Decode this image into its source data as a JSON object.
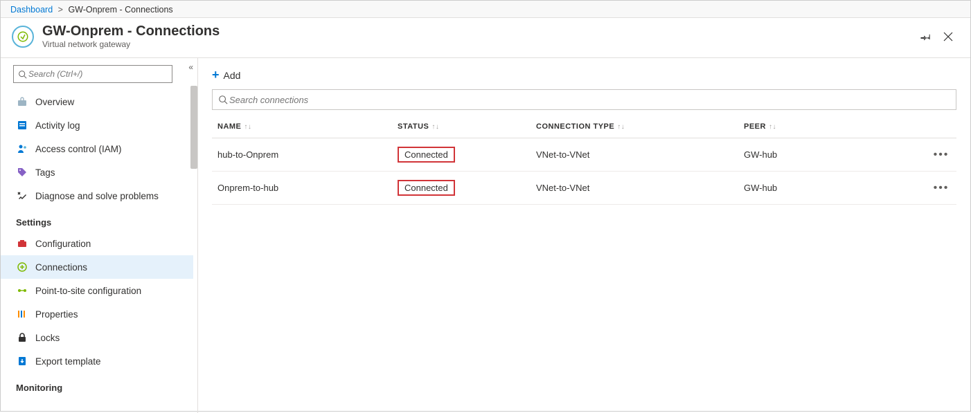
{
  "breadcrumb": {
    "root": "Dashboard",
    "current": "GW-Onprem - Connections"
  },
  "header": {
    "title": "GW-Onprem - Connections",
    "subtitle": "Virtual network gateway"
  },
  "sidebar": {
    "search_placeholder": "Search (Ctrl+/)",
    "items_top": [
      {
        "icon": "overview-icon",
        "label": "Overview",
        "color": "#59b4d9"
      },
      {
        "icon": "activity-log-icon",
        "label": "Activity log",
        "color": "#0078d4"
      },
      {
        "icon": "access-control-icon",
        "label": "Access control (IAM)",
        "color": "#0078d4"
      },
      {
        "icon": "tag-icon",
        "label": "Tags",
        "color": "#7e3e9d"
      },
      {
        "icon": "diagnose-icon",
        "label": "Diagnose and solve problems",
        "color": "#323130"
      }
    ],
    "section_settings": "Settings",
    "items_settings": [
      {
        "icon": "configuration-icon",
        "label": "Configuration",
        "color": "#d13438"
      },
      {
        "icon": "connections-icon",
        "label": "Connections",
        "color": "#57a300",
        "selected": true
      },
      {
        "icon": "p2s-icon",
        "label": "Point-to-site configuration",
        "color": "#57a300"
      },
      {
        "icon": "properties-icon",
        "label": "Properties",
        "color": "#ff8c00"
      },
      {
        "icon": "locks-icon",
        "label": "Locks",
        "color": "#323130"
      },
      {
        "icon": "export-template-icon",
        "label": "Export template",
        "color": "#0078d4"
      }
    ],
    "section_monitoring": "Monitoring"
  },
  "toolbar": {
    "add_label": "Add"
  },
  "content": {
    "search_placeholder": "Search connections",
    "columns": {
      "name": "NAME",
      "status": "STATUS",
      "ctype": "CONNECTION TYPE",
      "peer": "PEER"
    },
    "rows": [
      {
        "name": "hub-to-Onprem",
        "status": "Connected",
        "ctype": "VNet-to-VNet",
        "peer": "GW-hub"
      },
      {
        "name": "Onprem-to-hub",
        "status": "Connected",
        "ctype": "VNet-to-VNet",
        "peer": "GW-hub"
      }
    ]
  }
}
